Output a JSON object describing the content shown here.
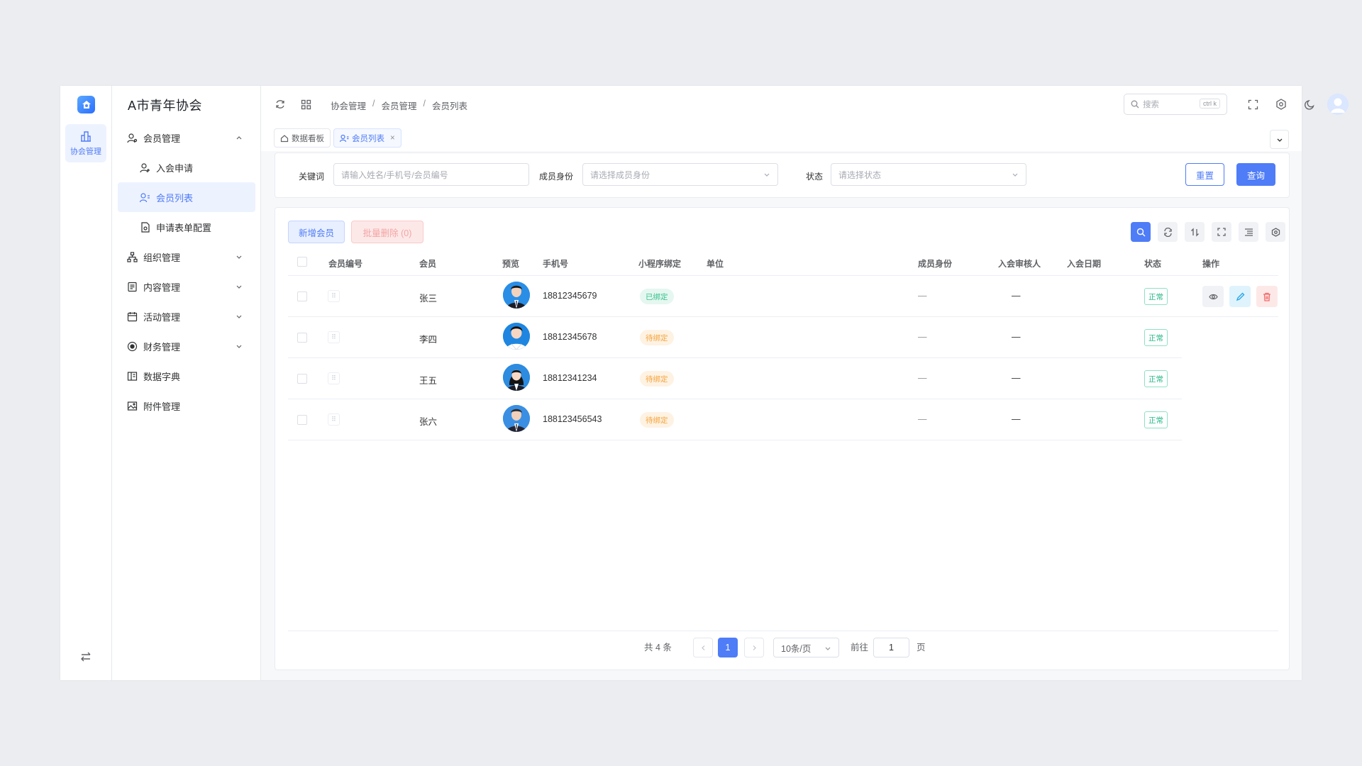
{
  "app": {
    "title": "A市青年协会"
  },
  "rail": {
    "item_label": "协会管理"
  },
  "sidebar": {
    "items": [
      {
        "label": "会员管理",
        "level": 1,
        "expanded": true
      },
      {
        "label": "入会申请",
        "level": 2
      },
      {
        "label": "会员列表",
        "level": 2,
        "active": true
      },
      {
        "label": "申请表单配置",
        "level": 2
      },
      {
        "label": "组织管理",
        "level": 1
      },
      {
        "label": "内容管理",
        "level": 1
      },
      {
        "label": "活动管理",
        "level": 1
      },
      {
        "label": "财务管理",
        "level": 1
      },
      {
        "label": "数据字典",
        "level": 1
      },
      {
        "label": "附件管理",
        "level": 1
      }
    ]
  },
  "header": {
    "breadcrumb": [
      "协会管理",
      "会员管理",
      "会员列表"
    ],
    "separator": "/",
    "search_placeholder": "搜索",
    "search_shortcut": "ctrl k"
  },
  "tabs": [
    {
      "label": "数据看板"
    },
    {
      "label": "会员列表",
      "active": true,
      "close": "×"
    }
  ],
  "filter": {
    "keyword_label": "关键词",
    "keyword_placeholder": "请输入姓名/手机号/会员编号",
    "identity_label": "成员身份",
    "identity_placeholder": "请选择成员身份",
    "status_label": "状态",
    "status_placeholder": "请选择状态",
    "reset_label": "重置",
    "query_label": "查询"
  },
  "toolbar": {
    "add_label": "新增会员",
    "batch_delete_label": "批量删除 (0)"
  },
  "table": {
    "columns": [
      "会员编号",
      "会员",
      "预览",
      "手机号",
      "小程序绑定",
      "单位",
      "成员身份",
      "入会审核人",
      "入会日期",
      "状态",
      "操作"
    ],
    "rows": [
      {
        "name": "张三",
        "phone": "18812345679",
        "bind": "已绑定",
        "bind_state": "bound",
        "identity": "—",
        "reviewer": "—",
        "status": "正常",
        "avatar": "male"
      },
      {
        "name": "李四",
        "phone": "18812345678",
        "bind": "待绑定",
        "bind_state": "pending",
        "identity": "—",
        "reviewer": "—",
        "status": "正常",
        "avatar": "male"
      },
      {
        "name": "王五",
        "phone": "18812341234",
        "bind": "待绑定",
        "bind_state": "pending",
        "identity": "—",
        "reviewer": "—",
        "status": "正常",
        "avatar": "female"
      },
      {
        "name": "张六",
        "phone": "188123456543",
        "bind": "待绑定",
        "bind_state": "pending",
        "identity": "—",
        "reviewer": "—",
        "status": "正常",
        "avatar": "male"
      }
    ]
  },
  "pagination": {
    "total_text": "共 4 条",
    "current_page": "1",
    "page_size": "10条/页",
    "goto_label": "前往",
    "goto_value": "1",
    "page_suffix": "页"
  },
  "colors": {
    "primary": "#4f7cf7",
    "success": "#28b88a",
    "warning": "#f4a43c",
    "danger": "#f36a6a"
  }
}
